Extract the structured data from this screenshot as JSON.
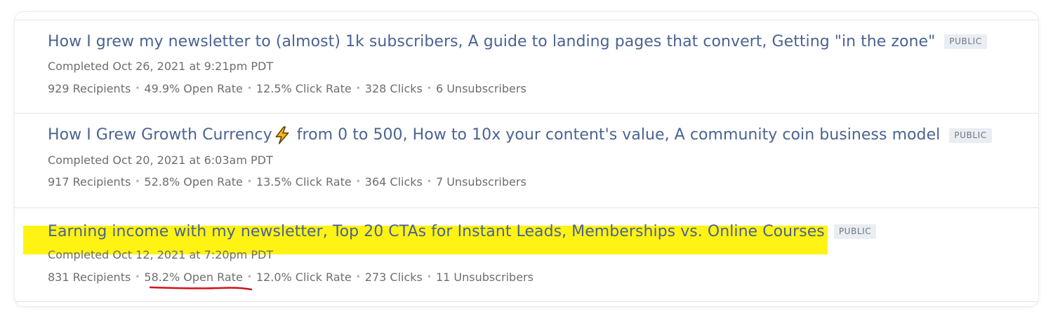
{
  "newsletters": [
    {
      "title": "How I grew my newsletter to (almost) 1k subscribers, A guide to landing pages that convert, Getting \"in the zone\"",
      "badge": "PUBLIC",
      "completed": "Completed Oct 26, 2021 at 9:21pm PDT",
      "recipients": "929 Recipients",
      "open_rate": "49.9% Open Rate",
      "click_rate": "12.5% Click Rate",
      "clicks": "328 Clicks",
      "unsubscribers": "6 Unsubscribers"
    },
    {
      "title_before_icon": "How I Grew Growth Currency",
      "title_icon": "lightning-bolt-icon",
      "title_after_icon": " from 0 to 500, How to 10x your content's value, A community coin business model",
      "badge": "PUBLIC",
      "completed": "Completed Oct 20, 2021 at 6:03am PDT",
      "recipients": "917 Recipients",
      "open_rate": "52.8% Open Rate",
      "click_rate": "13.5% Click Rate",
      "clicks": "364 Clicks",
      "unsubscribers": "7 Unsubscribers"
    },
    {
      "title": "Earning income with my newsletter, Top 20 CTAs for Instant Leads, Memberships vs. Online Courses",
      "badge": "PUBLIC",
      "completed": "Completed Oct 12, 2021 at 7:20pm PDT",
      "recipients": "831 Recipients",
      "open_rate": "58.2% Open Rate",
      "click_rate": "12.0% Click Rate",
      "clicks": "273 Clicks",
      "unsubscribers": "11 Unsubscribers"
    }
  ],
  "stat_separator": "•",
  "colors": {
    "link": "#4a6392",
    "meta_text": "#6e6e6e",
    "badge_bg": "#eaedf1",
    "highlight": "#fff200",
    "annotation_underline": "#d0121b"
  }
}
